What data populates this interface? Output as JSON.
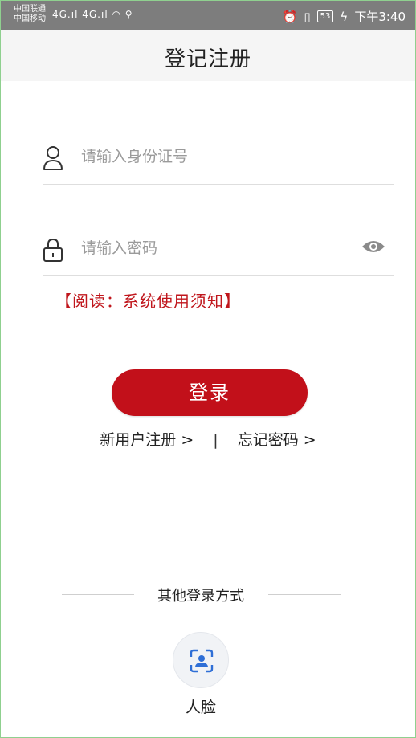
{
  "status_bar": {
    "carrier_1": "中国联通",
    "carrier_2": "中国移动",
    "signal": "4G.ıl 4G.ıl",
    "battery": "53",
    "time": "下午3:40"
  },
  "header": {
    "title": "登记注册"
  },
  "form": {
    "id_placeholder": "请输入身份证号",
    "password_placeholder": "请输入密码",
    "notice": "【阅读：系统使用须知】",
    "login_label": "登录"
  },
  "links": {
    "register": "新用户注册 >",
    "separator": "|",
    "forgot": "忘记密码 >"
  },
  "other_login": {
    "title": "其他登录方式",
    "face_label": "人脸"
  },
  "colors": {
    "accent": "#c2101a",
    "status_bar": "#7d7d7d",
    "header_bg": "#f5f5f5"
  }
}
